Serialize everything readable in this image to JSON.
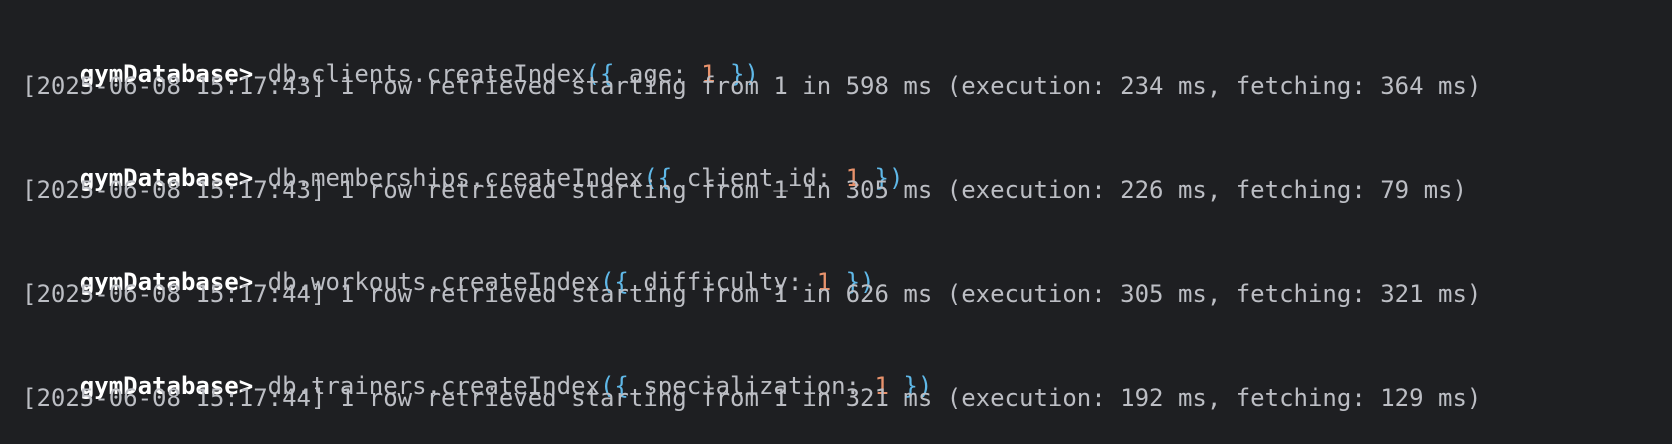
{
  "console": {
    "entries": [
      {
        "prompt": "gymDatabase> ",
        "call": "db.clients.createIndex",
        "open": "({ ",
        "key": "age: ",
        "value": "1",
        "close": " })",
        "result": "[2025-06-08 15:17:43] 1 row retrieved starting from 1 in 598 ms (execution: 234 ms, fetching: 364 ms)"
      },
      {
        "prompt": "gymDatabase> ",
        "call": "db.memberships.createIndex",
        "open": "({ ",
        "key": "client_id: ",
        "value": "1",
        "close": " })",
        "result": "[2025-06-08 15:17:43] 1 row retrieved starting from 1 in 305 ms (execution: 226 ms, fetching: 79 ms)"
      },
      {
        "prompt": "gymDatabase> ",
        "call": "db.workouts.createIndex",
        "open": "({ ",
        "key": "difficulty: ",
        "value": "1",
        "close": " })",
        "result": "[2025-06-08 15:17:44] 1 row retrieved starting from 1 in 626 ms (execution: 305 ms, fetching: 321 ms)"
      },
      {
        "prompt": "gymDatabase> ",
        "call": "db.trainers.createIndex",
        "open": "({ ",
        "key": "specialization: ",
        "value": "1",
        "close": " })",
        "result": "[2025-06-08 15:17:44] 1 row retrieved starting from 1 in 321 ms (execution: 192 ms, fetching: 129 ms)"
      }
    ]
  },
  "colors": {
    "background": "#1e1f22",
    "text": "#bcbec4",
    "prompt": "#ffffff",
    "brace": "#5fb8e8",
    "number": "#e8926c"
  }
}
